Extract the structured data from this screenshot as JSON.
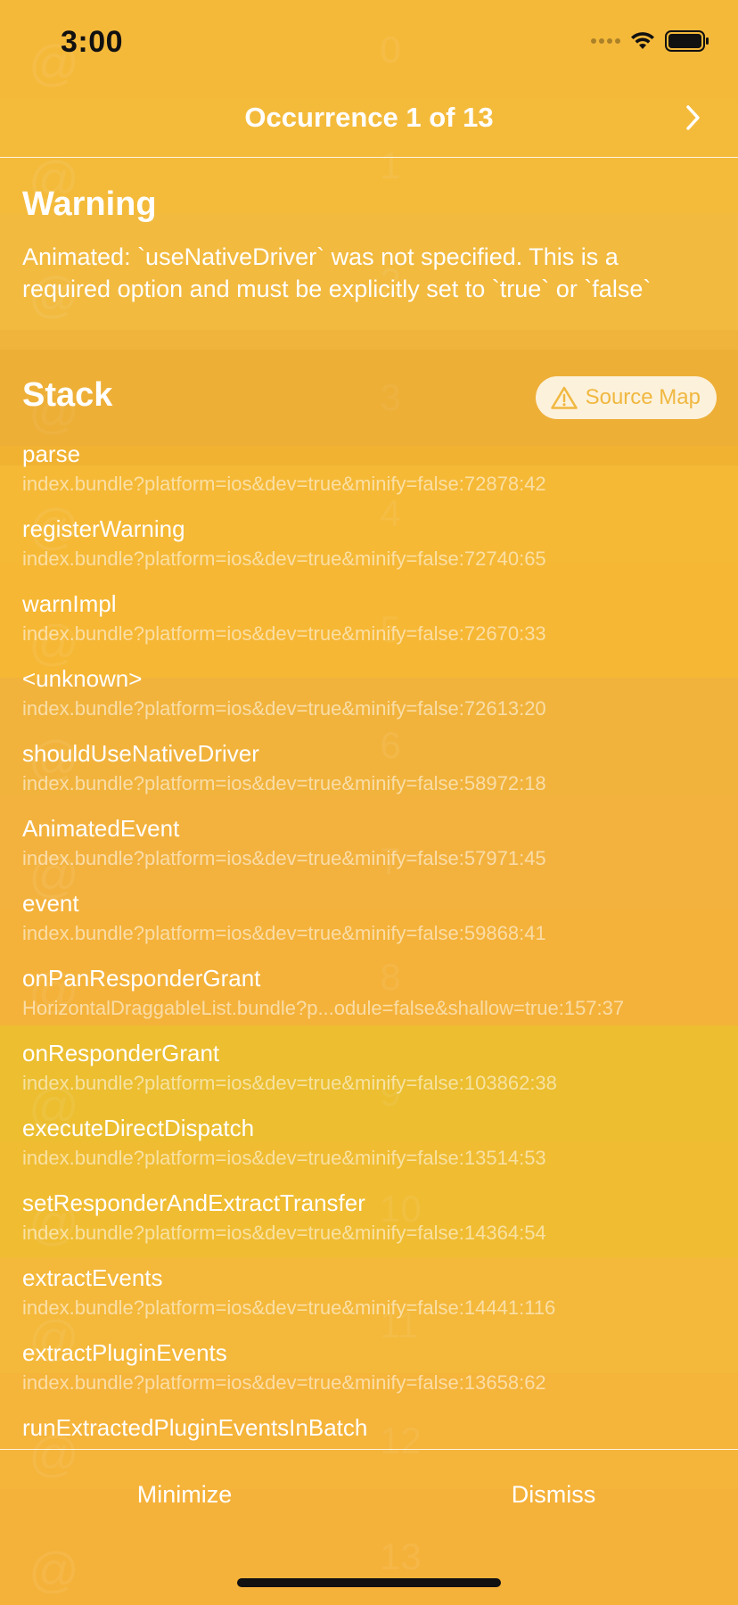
{
  "status_bar": {
    "time": "3:00",
    "icons": [
      "cellular-signal-icon",
      "wifi-icon",
      "battery-icon"
    ]
  },
  "header": {
    "title": "Occurrence 1 of 13",
    "next_icon": "chevron-right-icon"
  },
  "warning": {
    "title": "Warning",
    "message": "Animated: `useNativeDriver` was not specified. This is a required option and must be explicitly set to `true` or `false`"
  },
  "stack": {
    "title": "Stack",
    "source_map_label": "Source Map",
    "source_map_icon": "warning-triangle-icon",
    "frames": [
      {
        "method": "parse",
        "location": "index.bundle?platform=ios&dev=true&minify=false:72878:42"
      },
      {
        "method": "registerWarning",
        "location": "index.bundle?platform=ios&dev=true&minify=false:72740:65"
      },
      {
        "method": "warnImpl",
        "location": "index.bundle?platform=ios&dev=true&minify=false:72670:33"
      },
      {
        "method": "<unknown>",
        "location": "index.bundle?platform=ios&dev=true&minify=false:72613:20"
      },
      {
        "method": "shouldUseNativeDriver",
        "location": "index.bundle?platform=ios&dev=true&minify=false:58972:18"
      },
      {
        "method": "AnimatedEvent",
        "location": "index.bundle?platform=ios&dev=true&minify=false:57971:45"
      },
      {
        "method": "event",
        "location": "index.bundle?platform=ios&dev=true&minify=false:59868:41"
      },
      {
        "method": "onPanResponderGrant",
        "location": "HorizontalDraggableList.bundle?p...odule=false&shallow=true:157:37"
      },
      {
        "method": "onResponderGrant",
        "location": "index.bundle?platform=ios&dev=true&minify=false:103862:38"
      },
      {
        "method": "executeDirectDispatch",
        "location": "index.bundle?platform=ios&dev=true&minify=false:13514:53"
      },
      {
        "method": "setResponderAndExtractTransfer",
        "location": "index.bundle?platform=ios&dev=true&minify=false:14364:54"
      },
      {
        "method": "extractEvents",
        "location": "index.bundle?platform=ios&dev=true&minify=false:14441:116"
      },
      {
        "method": "extractPluginEvents",
        "location": "index.bundle?platform=ios&dev=true&minify=false:13658:62"
      },
      {
        "method": "runExtractedPluginEventsInBatch",
        "location": ""
      }
    ]
  },
  "footer": {
    "minimize_label": "Minimize",
    "dismiss_label": "Dismiss"
  },
  "background": {
    "base_color": "#f4b63a",
    "ghost_numbers": [
      "0",
      "1",
      "2",
      "3",
      "4",
      "5",
      "6",
      "7",
      "8",
      "9",
      "10",
      "11",
      "12",
      "13"
    ],
    "ghost_symbol": "@"
  }
}
